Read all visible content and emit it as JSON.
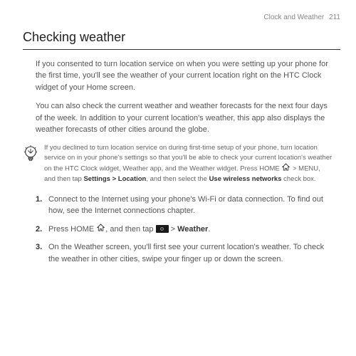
{
  "header": {
    "section": "Clock and Weather",
    "page": "211"
  },
  "title": "Checking weather",
  "para1": "If you consented to turn location service on when you were setting up your phone for the first time, you'll see the weather of your current location right on the HTC Clock widget of your Home screen.",
  "para2": "You can also check the current weather and weather forecasts for the next four days of the week. In addition to your current location's weather, this app also displays the weather forecasts of other cities around the globe.",
  "tip": {
    "part1": "If you declined to turn location service on during first-time setup of your phone, turn location service on in your phone's settings so that you'll be able to check your current location's weather on the HTC Clock widget, Weather app, and the Weather widget. Press HOME ",
    "part2": " > MENU, and then tap ",
    "bold1": "Settings > Location",
    "part3": ", and then select the ",
    "bold2": "Use wireless networks",
    "part4": " check box."
  },
  "steps": {
    "s1": "Connect to the Internet using your phone's Wi-Fi or data connection. To find out how, see the Internet connections chapter.",
    "s2a": "Press HOME ",
    "s2b": ", and then tap ",
    "s2c": " > ",
    "s2d": "Weather",
    "s2e": ".",
    "s3": "On the Weather screen, you'll first see your current location's weather. To check the weather in other cities, swipe your finger up or down the screen."
  }
}
